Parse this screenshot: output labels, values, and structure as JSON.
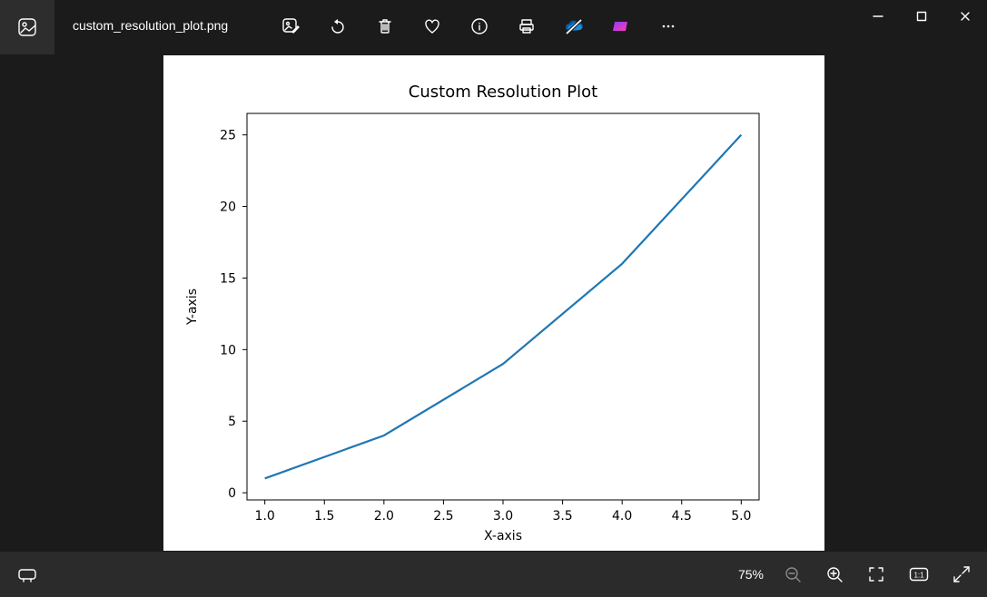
{
  "filename": "custom_resolution_plot.png",
  "zoom_level": "75%",
  "chart_data": {
    "type": "line",
    "x": [
      1,
      2,
      3,
      4,
      5
    ],
    "y": [
      1,
      4,
      9,
      16,
      25
    ],
    "title": "Custom Resolution Plot",
    "xlabel": "X-axis",
    "ylabel": "Y-axis",
    "xticks": [
      1.0,
      1.5,
      2.0,
      2.5,
      3.0,
      3.5,
      4.0,
      4.5,
      5.0
    ],
    "yticks": [
      0,
      5,
      10,
      15,
      20,
      25
    ],
    "xlim": [
      0.85,
      5.15
    ],
    "ylim": [
      -0.5,
      26.5
    ]
  }
}
